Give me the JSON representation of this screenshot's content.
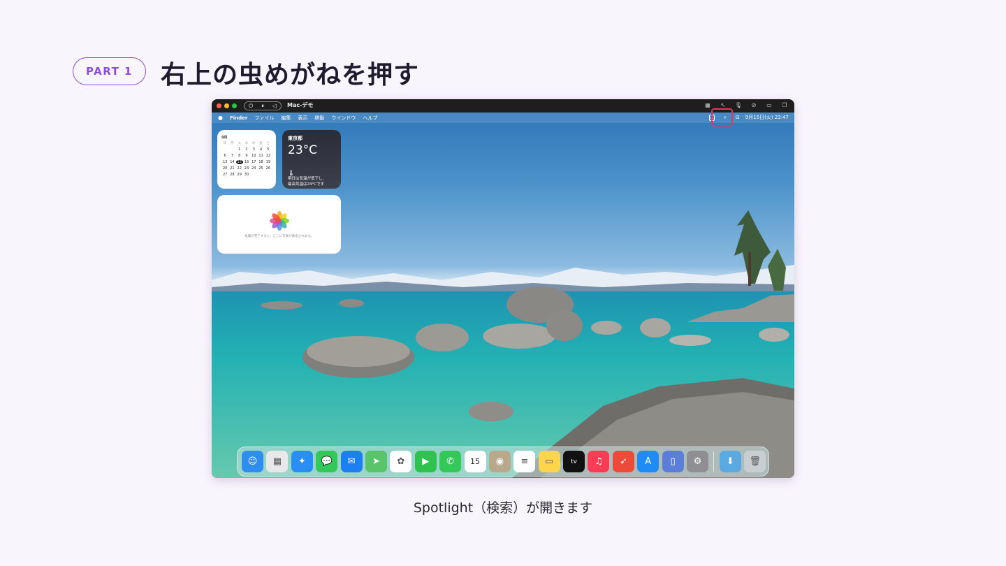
{
  "slide": {
    "badge": "PART 1",
    "heading": "右上の虫めがねを押す",
    "caption": "Spotlight（検索）が開きます"
  },
  "window": {
    "title": "Mac-デモ",
    "controls": [
      "⏻",
      "⏸",
      "◁"
    ]
  },
  "menubar": {
    "apple": "",
    "app_name": "Finder",
    "items": [
      "ファイル",
      "編集",
      "表示",
      "移動",
      "ウインドウ",
      "ヘルプ"
    ],
    "input_indicator": "A",
    "datetime": "9月15日(火) 23:47"
  },
  "calendar_widget": {
    "month": "9月",
    "weekdays": [
      "日",
      "月",
      "火",
      "水",
      "木",
      "金",
      "土"
    ],
    "days": [
      "",
      "",
      "1",
      "2",
      "3",
      "4",
      "5",
      "6",
      "7",
      "8",
      "9",
      "10",
      "11",
      "12",
      "13",
      "14",
      "15",
      "16",
      "17",
      "18",
      "19",
      "20",
      "21",
      "22",
      "23",
      "24",
      "25",
      "26",
      "27",
      "28",
      "29",
      "30",
      "",
      "",
      ""
    ],
    "today": "15"
  },
  "weather_widget": {
    "city": "東京都",
    "temperature": "23°C",
    "line1": "明日は気温が低下し、",
    "line2": "最高気温は24°Cです"
  },
  "photos_widget": {
    "message": "処理が完了すると、ここに写真が表示されます。"
  },
  "dock": {
    "apps": [
      {
        "name": "Finder",
        "icon": "finder-icon",
        "color": "#2f8df0",
        "glyph": "☺"
      },
      {
        "name": "Launchpad",
        "icon": "launchpad-icon",
        "color": "#e8e8ea",
        "glyph": "▦"
      },
      {
        "name": "Safari",
        "icon": "safari-icon",
        "color": "#2a8ff5",
        "glyph": "✦"
      },
      {
        "name": "Messages",
        "icon": "messages-icon",
        "color": "#34c759",
        "glyph": "💬"
      },
      {
        "name": "Mail",
        "icon": "mail-icon",
        "color": "#1e7ff0",
        "glyph": "✉"
      },
      {
        "name": "Maps",
        "icon": "maps-icon",
        "color": "#5ac46a",
        "glyph": "➤"
      },
      {
        "name": "Photos",
        "icon": "photos-icon",
        "color": "#ffffff",
        "glyph": "✿"
      },
      {
        "name": "FaceTime",
        "icon": "facetime-icon",
        "color": "#2fc24f",
        "glyph": "▶"
      },
      {
        "name": "Phone",
        "icon": "phone-icon",
        "color": "#34c759",
        "glyph": "✆"
      },
      {
        "name": "Calendar",
        "icon": "calendar-icon",
        "color": "#ffffff",
        "glyph": "15"
      },
      {
        "name": "Contacts",
        "icon": "contacts-icon",
        "color": "#b8a98c",
        "glyph": "◉"
      },
      {
        "name": "Reminders",
        "icon": "reminders-icon",
        "color": "#ffffff",
        "glyph": "≡"
      },
      {
        "name": "Notes",
        "icon": "notes-icon",
        "color": "#fbd54a",
        "glyph": "▭"
      },
      {
        "name": "TV",
        "icon": "tv-icon",
        "color": "#111111",
        "glyph": "tv"
      },
      {
        "name": "Music",
        "icon": "music-icon",
        "color": "#fa3c55",
        "glyph": "♫"
      },
      {
        "name": "Rocket",
        "icon": "rocket-icon",
        "color": "#ee4a3a",
        "glyph": "➶"
      },
      {
        "name": "App Store",
        "icon": "app-store-icon",
        "color": "#1f8cf5",
        "glyph": "A"
      },
      {
        "name": "Preview",
        "icon": "preview-icon",
        "color": "#5b7ed8",
        "glyph": "▯"
      },
      {
        "name": "System Settings",
        "icon": "settings-icon",
        "color": "#8e8e93",
        "glyph": "⚙"
      }
    ],
    "extras": [
      {
        "name": "Downloads",
        "icon": "folder-icon",
        "color": "#5aa9e0",
        "glyph": "⬇"
      },
      {
        "name": "Trash",
        "icon": "trash-icon",
        "color": "#c9ced3",
        "glyph": "🗑"
      }
    ]
  }
}
